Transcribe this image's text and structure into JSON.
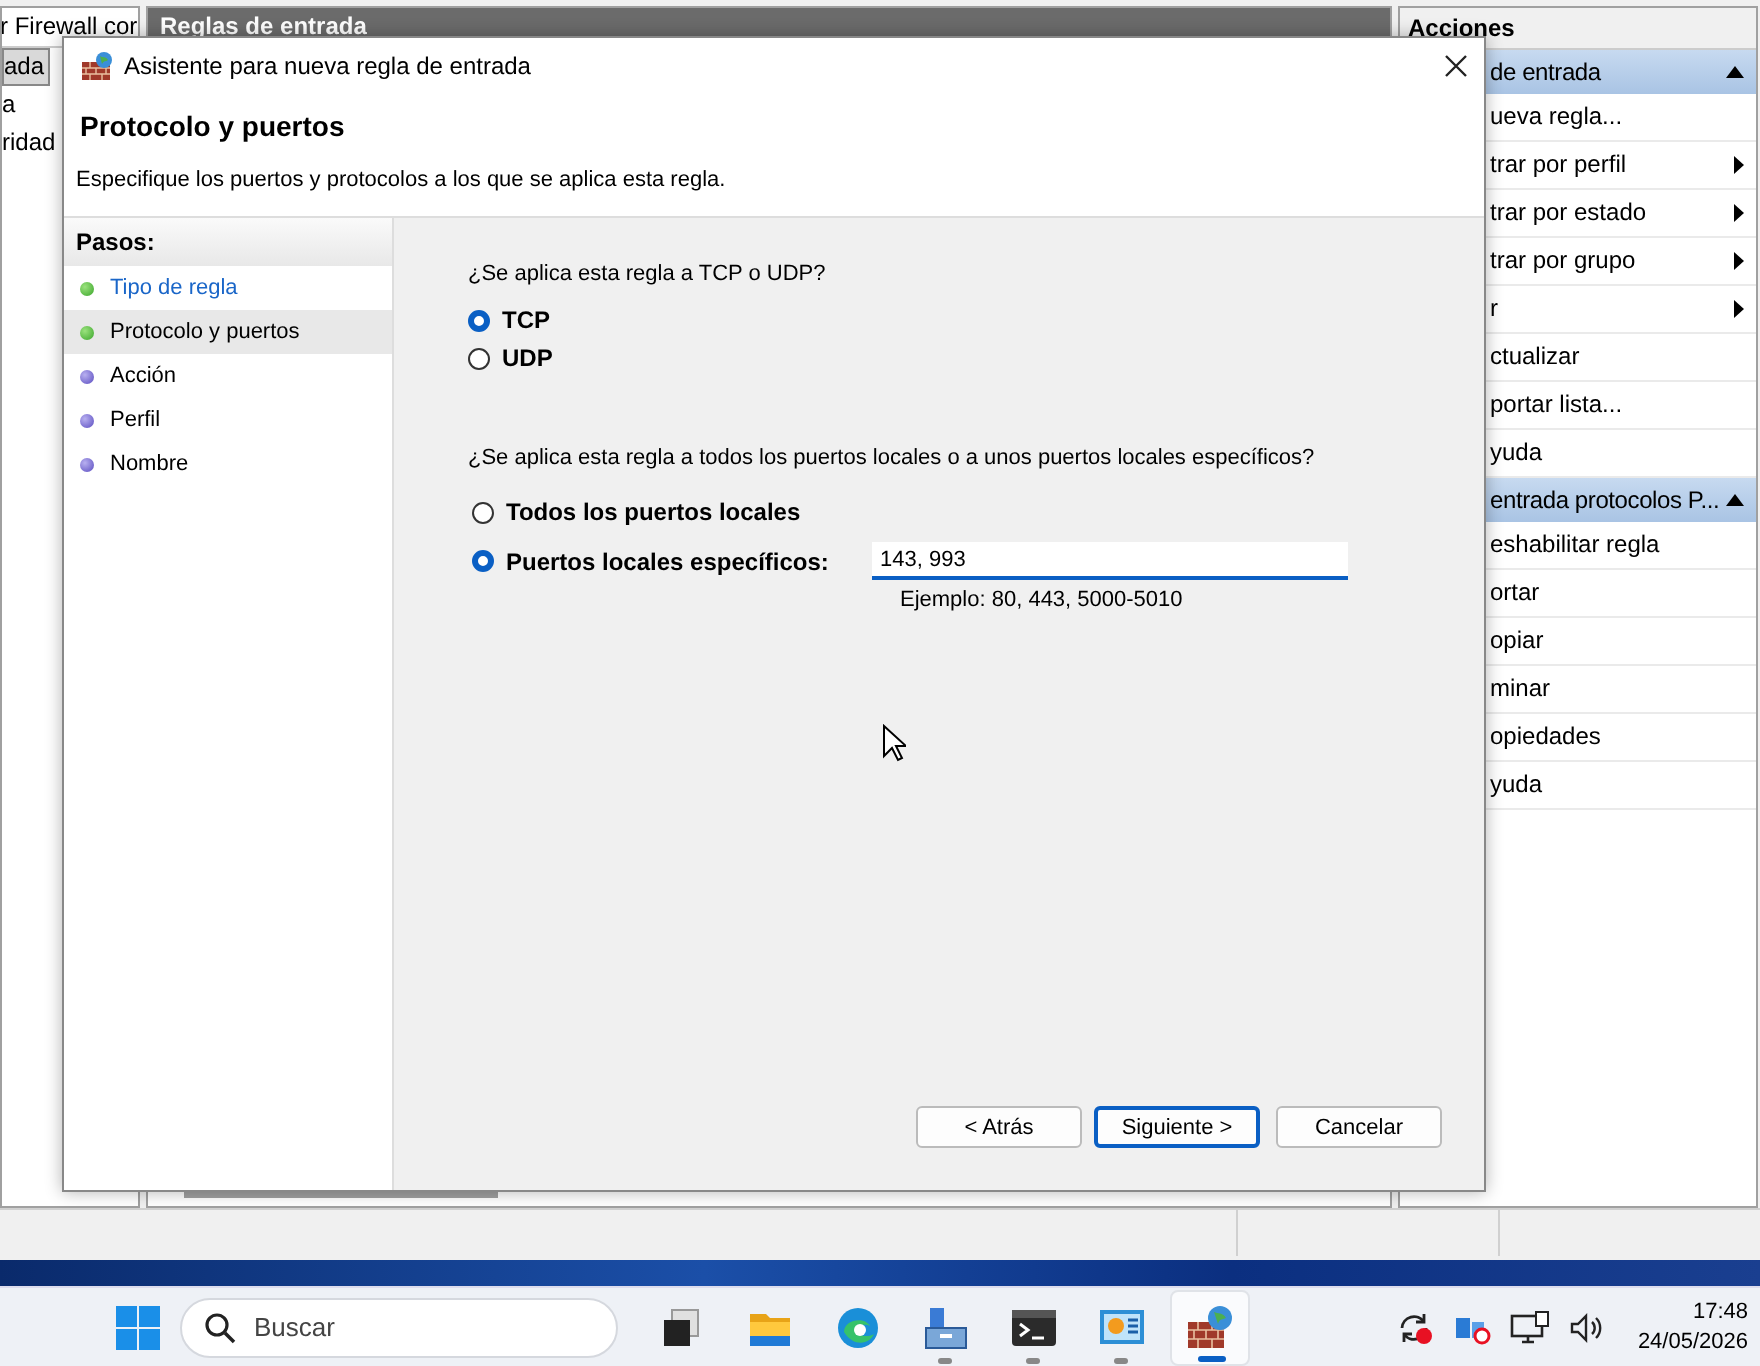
{
  "background_app": {
    "tree_items": [
      {
        "label": "r Firewall cor",
        "selected": false
      },
      {
        "label": "ada",
        "selected": true
      },
      {
        "label": "a",
        "selected": false
      },
      {
        "label": "ridad",
        "selected": false
      }
    ],
    "center_title": "Reglas de entrada",
    "actions_title": "Acciones",
    "actions": [
      {
        "kind": "header",
        "label": "de entrada"
      },
      {
        "kind": "item",
        "label": "ueva regla...",
        "submenu": false
      },
      {
        "kind": "item",
        "label": "trar por perfil",
        "submenu": true
      },
      {
        "kind": "item",
        "label": "trar por estado",
        "submenu": true
      },
      {
        "kind": "item",
        "label": "trar por grupo",
        "submenu": true
      },
      {
        "kind": "item",
        "label": "r",
        "submenu": true
      },
      {
        "kind": "item",
        "label": "ctualizar",
        "submenu": false
      },
      {
        "kind": "item",
        "label": "portar lista...",
        "submenu": false
      },
      {
        "kind": "item",
        "label": "yuda",
        "submenu": false
      },
      {
        "kind": "header",
        "label": "entrada protocolos P..."
      },
      {
        "kind": "item",
        "label": "eshabilitar regla",
        "submenu": false
      },
      {
        "kind": "item",
        "label": "ortar",
        "submenu": false
      },
      {
        "kind": "item",
        "label": "opiar",
        "submenu": false
      },
      {
        "kind": "item",
        "label": "minar",
        "submenu": false
      },
      {
        "kind": "item",
        "label": "opiedades",
        "submenu": false
      },
      {
        "kind": "item",
        "label": "yuda",
        "submenu": false
      }
    ]
  },
  "dialog": {
    "title": "Asistente para nueva regla de entrada",
    "heading": "Protocolo y puertos",
    "description": "Especifique los puertos y protocolos a los que se aplica esta regla.",
    "steps_title": "Pasos:",
    "steps": [
      {
        "label": "Tipo de regla",
        "done": true,
        "selected": false
      },
      {
        "label": "Protocolo y puertos",
        "done": true,
        "selected": true
      },
      {
        "label": "Acción",
        "done": false,
        "selected": false
      },
      {
        "label": "Perfil",
        "done": false,
        "selected": false
      },
      {
        "label": "Nombre",
        "done": false,
        "selected": false
      }
    ],
    "protocol_question": "¿Se aplica esta regla a TCP o UDP?",
    "protocols": [
      {
        "label": "TCP",
        "selected": true
      },
      {
        "label": "UDP",
        "selected": false
      }
    ],
    "ports_question": "¿Se aplica esta regla a todos los puertos locales o a unos puertos locales específicos?",
    "port_options": [
      {
        "label": "Todos los puertos locales",
        "selected": false
      },
      {
        "label": "Puertos locales específicos:",
        "selected": true
      }
    ],
    "ports_field": {
      "value": "143, 993"
    },
    "ports_example": "Ejemplo: 80, 443, 5000-5010",
    "buttons": [
      {
        "label": "< Atrás",
        "default": false
      },
      {
        "label": "Siguiente >",
        "default": true
      },
      {
        "label": "Cancelar",
        "default": false
      }
    ]
  },
  "taskbar": {
    "search": {
      "placeholder": "Buscar"
    },
    "apps": [
      {
        "kind": "taskview",
        "running": false,
        "active": false
      },
      {
        "kind": "folder",
        "running": false,
        "active": false
      },
      {
        "kind": "browser",
        "running": false,
        "active": false
      },
      {
        "kind": "server",
        "running": true,
        "active": false
      },
      {
        "kind": "terminal",
        "running": true,
        "active": false
      },
      {
        "kind": "panel",
        "running": true,
        "active": false
      },
      {
        "kind": "firewall",
        "running": false,
        "active": true
      }
    ],
    "time": "17:48",
    "date": "24/05/2026"
  }
}
